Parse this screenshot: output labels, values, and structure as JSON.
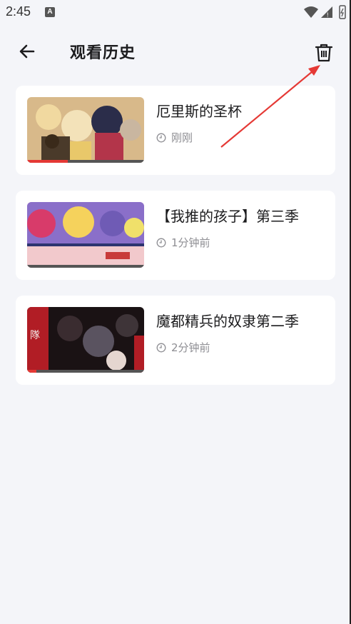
{
  "status_bar": {
    "time": "2:45",
    "app_icon_letter": "A",
    "icons": [
      "wifi-icon",
      "signal-icon",
      "battery-icon"
    ]
  },
  "header": {
    "title": "观看历史",
    "back_icon": "back-arrow-icon",
    "delete_icon": "trash-icon"
  },
  "history": [
    {
      "title": "厄里斯的圣杯",
      "time": "刚刚",
      "progress": 0.35,
      "thumb_colors": [
        "#d8b98a",
        "#b3354a",
        "#2b2d4a",
        "#f1d9a0"
      ]
    },
    {
      "title": "【我推的孩子】第三季",
      "time": "1分钟前",
      "progress": 0.0,
      "thumb_colors": [
        "#e79bc4",
        "#6f5bb5",
        "#f5d25c",
        "#2d3470"
      ]
    },
    {
      "title": "魔都精兵的奴隶第二季",
      "time": "2分钟前",
      "progress": 0.08,
      "thumb_colors": [
        "#1a1214",
        "#b11d25",
        "#5a5360",
        "#e5d6d0"
      ]
    }
  ],
  "colors": {
    "background": "#f4f5f9",
    "card": "#ffffff",
    "progress": "#e53935",
    "annotation_arrow": "#e53935"
  }
}
